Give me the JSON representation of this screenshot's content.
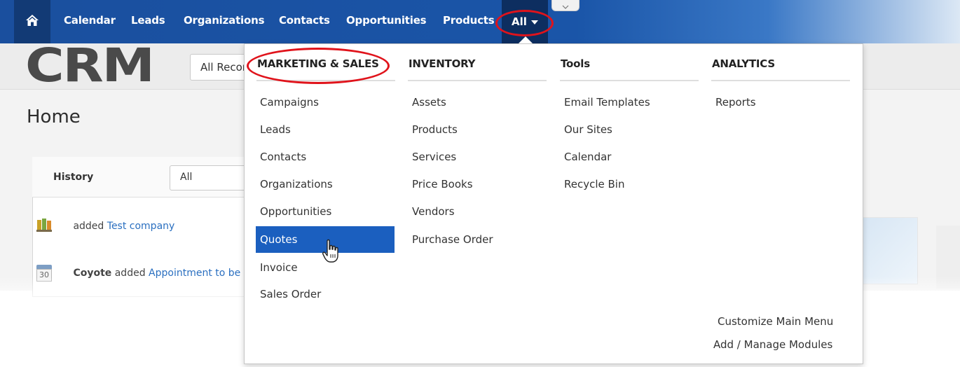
{
  "nav": {
    "items": [
      {
        "label": "Calendar"
      },
      {
        "label": "Leads"
      },
      {
        "label": "Organizations"
      },
      {
        "label": "Contacts"
      },
      {
        "label": "Opportunities"
      },
      {
        "label": "Products"
      }
    ],
    "all_label": "All"
  },
  "page": {
    "logo": "CRM",
    "records_select": "All Records",
    "title": "Home"
  },
  "widget": {
    "title": "History",
    "filter": "All",
    "rows": [
      {
        "actor": "",
        "action": "added ",
        "link": "Test company"
      },
      {
        "actor": "Coyote",
        "action": " added ",
        "link": "Appointment to be"
      }
    ],
    "calendar_day": "30"
  },
  "menu": {
    "columns": [
      {
        "heading": "MARKETING & SALES",
        "links": [
          "Campaigns",
          "Leads",
          "Contacts",
          "Organizations",
          "Opportunities",
          "Quotes",
          "Invoice",
          "Sales Order"
        ]
      },
      {
        "heading": "INVENTORY",
        "links": [
          "Assets",
          "Products",
          "Services",
          "Price Books",
          "Vendors",
          "Purchase Order"
        ]
      },
      {
        "heading": "Tools",
        "links": [
          "Email Templates",
          "Our Sites",
          "Calendar",
          "Recycle Bin"
        ]
      },
      {
        "heading": "ANALYTICS",
        "links": [
          "Reports"
        ]
      }
    ],
    "active_link": "Quotes",
    "footer": {
      "customize": "Customize Main Menu",
      "manage": "Add / Manage Modules"
    }
  },
  "colors": {
    "nav_bg": "#1a4f9e",
    "active_item_bg": "#1b5fbf",
    "highlight_ring": "#e0131b",
    "link": "#2a6fc0"
  },
  "icons": [
    "home-icon",
    "caret-down-icon",
    "chevron-down-icon",
    "organization-icon",
    "calendar-icon",
    "hand-cursor-icon"
  ]
}
